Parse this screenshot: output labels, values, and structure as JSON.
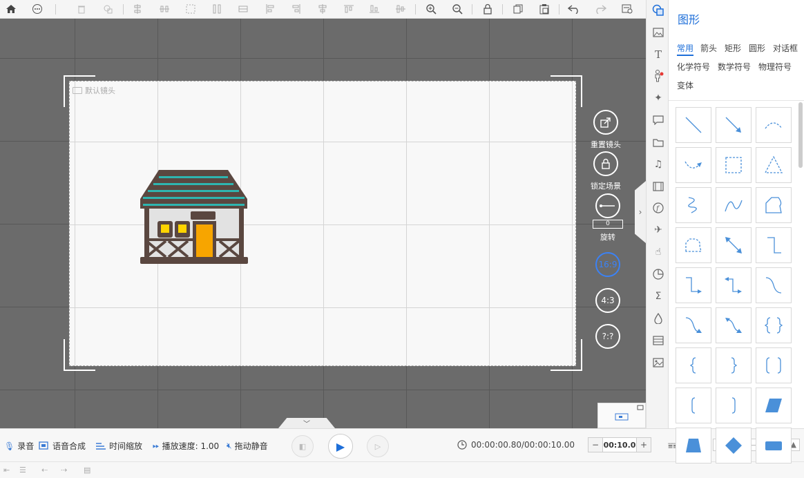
{
  "toolbar": {
    "icons": [
      "home-icon",
      "more-icon",
      "delete-icon",
      "layer-icon",
      "align-v-icon",
      "align-h-icon",
      "group-icon",
      "ungroup-icon",
      "distribute-icon",
      "align-left-icon",
      "align-right-icon",
      "align-center-icon",
      "align-top-icon",
      "align-bottom-icon",
      "align-middle-icon",
      "zoom-in-icon",
      "zoom-out-icon",
      "lock-icon",
      "copy-icon",
      "paste-icon",
      "undo-icon",
      "redo-icon",
      "settings-icon"
    ]
  },
  "canvas": {
    "camera_label": "默认镜头"
  },
  "side_controls": {
    "reset_label": "重置镜头",
    "lock_label": "锁定场景",
    "rotate_label": "旋转",
    "rotate_value": "0",
    "ratio_169": "16:9",
    "ratio_43": "4:3",
    "ratio_custom": "?:?"
  },
  "bottombar": {
    "record": "录音",
    "tts": "语音合成",
    "time_scale": "时间缩放",
    "speed": "播放速度: 1.00",
    "drag_mute": "拖动静音",
    "time": "00:00:00.80/00:00:10.00",
    "duration": "00:10.0",
    "minus": "−",
    "plus": "+"
  },
  "panel": {
    "title": "图形",
    "categories": [
      "常用",
      "箭头",
      "矩形",
      "圆形",
      "对话框",
      "化学符号",
      "数学符号",
      "物理符号",
      "变体"
    ],
    "shape_color": "#4a90d9"
  }
}
